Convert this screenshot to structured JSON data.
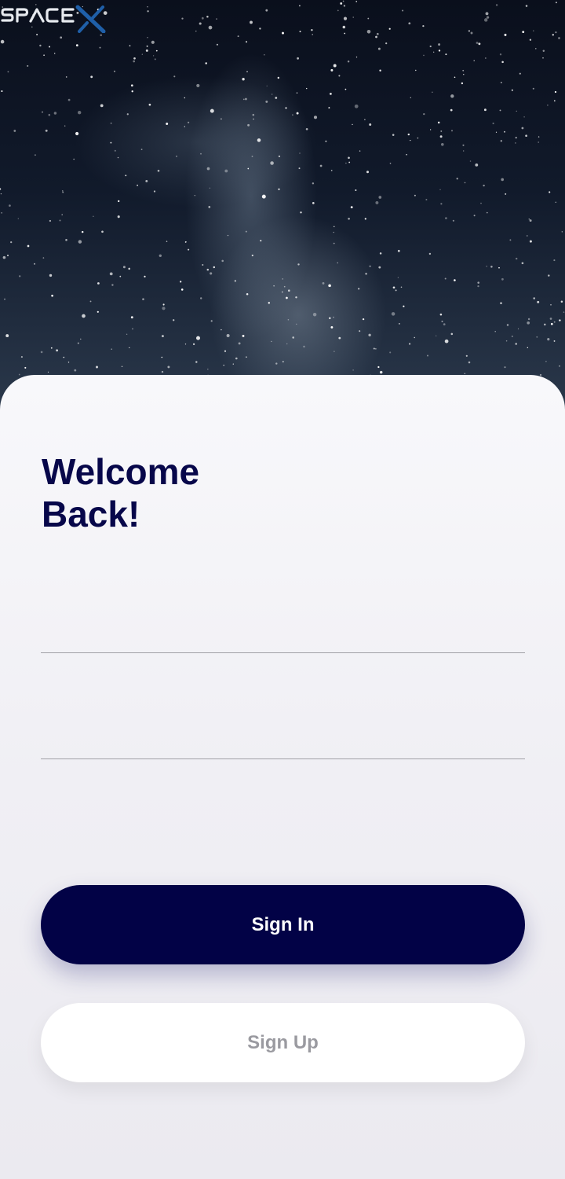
{
  "header": {
    "logo_text": "SPACEX",
    "logo_icon": "spacex-logo-icon"
  },
  "login": {
    "title_line1": "Welcome",
    "title_line2": "Back!",
    "email_value": "",
    "password_value": "",
    "sign_in_label": "Sign In",
    "sign_up_label": "Sign Up"
  },
  "colors": {
    "brand_navy": "#020246",
    "title_navy": "#07074a",
    "logo_blue": "#1f5fa8",
    "secondary_text": "#9a9aa0"
  }
}
